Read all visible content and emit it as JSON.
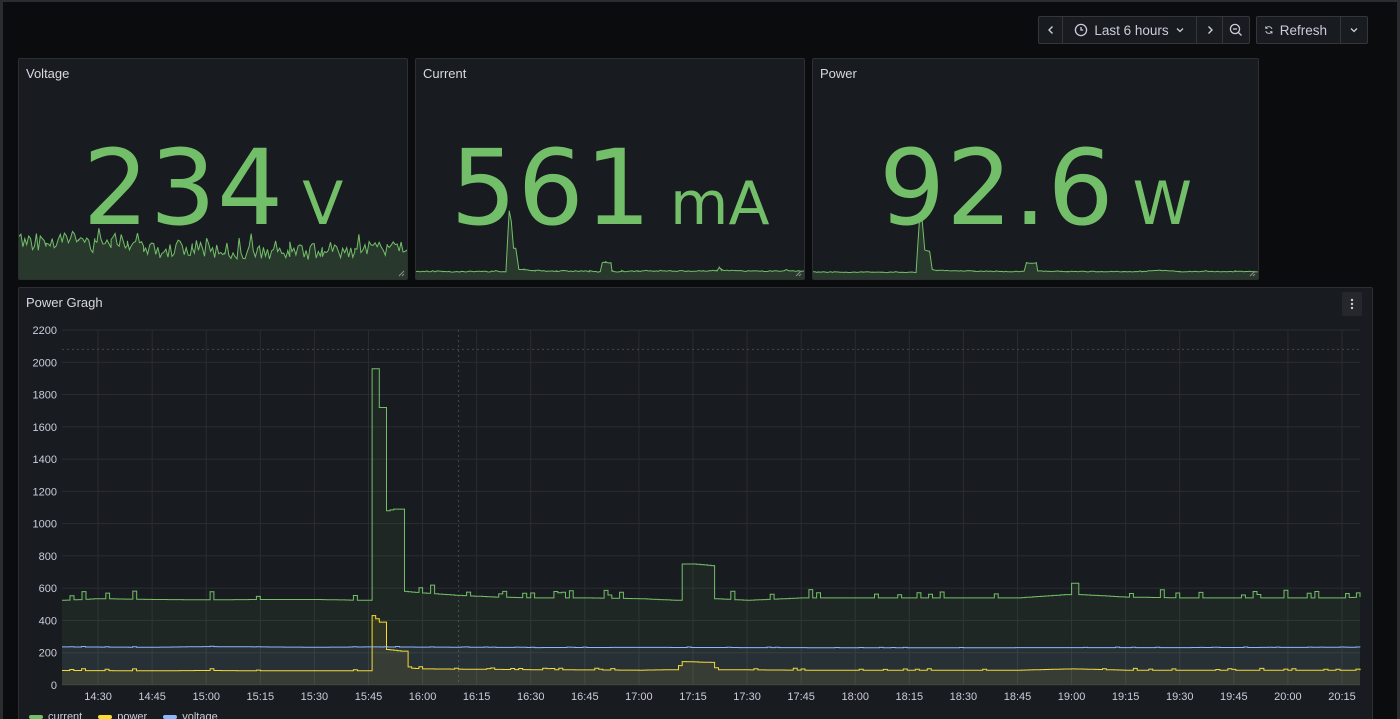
{
  "toolbar": {
    "time_range_label": "Last 6 hours",
    "refresh_label": "Refresh"
  },
  "panels": [
    {
      "title": "Voltage",
      "value": "234",
      "unit": "V"
    },
    {
      "title": "Current",
      "value": "561",
      "unit": "mA"
    },
    {
      "title": "Power",
      "value": "92.6",
      "unit": "W"
    }
  ],
  "graph": {
    "title": "Power Gragh"
  },
  "colors": {
    "accent_green": "#73bf69",
    "yellow": "#fade2a",
    "blue": "#8ab8ff",
    "panel_bg": "#181b1f"
  },
  "chart_data": {
    "type": "line",
    "title": "Power Gragh",
    "x": [
      "14:30",
      "14:45",
      "15:00",
      "15:15",
      "15:30",
      "15:45",
      "16:00",
      "16:15",
      "16:30",
      "16:45",
      "17:00",
      "17:15",
      "17:30",
      "17:45",
      "18:00",
      "18:15",
      "18:30",
      "18:45",
      "19:00",
      "19:15",
      "19:30",
      "19:45",
      "20:00",
      "20:15"
    ],
    "ylim": [
      0,
      2200
    ],
    "yticks": [
      0,
      200,
      400,
      600,
      800,
      1000,
      1200,
      1400,
      1600,
      1800,
      2000,
      2200
    ],
    "grid": true,
    "legend_position": "bottom-left",
    "series": [
      {
        "name": "current",
        "color": "#73bf69",
        "points": [
          [
            "14:20",
            525
          ],
          [
            "14:30",
            535
          ],
          [
            "14:45",
            530
          ],
          [
            "15:00",
            528
          ],
          [
            "15:15",
            530
          ],
          [
            "15:30",
            530
          ],
          [
            "15:43",
            525
          ],
          [
            "15:46",
            1960
          ],
          [
            "15:48",
            1720
          ],
          [
            "15:50",
            1080
          ],
          [
            "15:52",
            1090
          ],
          [
            "15:55",
            580
          ],
          [
            "16:00",
            570
          ],
          [
            "16:10",
            555
          ],
          [
            "16:20",
            545
          ],
          [
            "16:30",
            540
          ],
          [
            "16:45",
            540
          ],
          [
            "17:00",
            535
          ],
          [
            "17:10",
            525
          ],
          [
            "17:12",
            750
          ],
          [
            "17:15",
            750
          ],
          [
            "17:20",
            740
          ],
          [
            "17:21",
            535
          ],
          [
            "17:30",
            525
          ],
          [
            "17:45",
            540
          ],
          [
            "18:00",
            540
          ],
          [
            "18:15",
            540
          ],
          [
            "18:30",
            540
          ],
          [
            "18:45",
            540
          ],
          [
            "18:58",
            560
          ],
          [
            "19:00",
            630
          ],
          [
            "19:02",
            560
          ],
          [
            "19:15",
            545
          ],
          [
            "19:30",
            540
          ],
          [
            "19:45",
            540
          ],
          [
            "20:00",
            540
          ],
          [
            "20:15",
            540
          ],
          [
            "20:20",
            545
          ]
        ]
      },
      {
        "name": "power",
        "color": "#fade2a",
        "points": [
          [
            "14:20",
            90
          ],
          [
            "14:45",
            88
          ],
          [
            "15:00",
            90
          ],
          [
            "15:15",
            88
          ],
          [
            "15:30",
            88
          ],
          [
            "15:43",
            88
          ],
          [
            "15:46",
            430
          ],
          [
            "15:48",
            390
          ],
          [
            "15:50",
            220
          ],
          [
            "15:54",
            210
          ],
          [
            "15:56",
            105
          ],
          [
            "16:00",
            100
          ],
          [
            "16:30",
            95
          ],
          [
            "17:00",
            92
          ],
          [
            "17:10",
            95
          ],
          [
            "17:12",
            145
          ],
          [
            "17:20",
            140
          ],
          [
            "17:21",
            95
          ],
          [
            "17:45",
            92
          ],
          [
            "18:00",
            92
          ],
          [
            "18:30",
            92
          ],
          [
            "18:45",
            92
          ],
          [
            "19:00",
            100
          ],
          [
            "19:15",
            92
          ],
          [
            "19:30",
            92
          ],
          [
            "20:00",
            92
          ],
          [
            "20:20",
            92
          ]
        ]
      },
      {
        "name": "voltage",
        "color": "#8ab8ff",
        "points": [
          [
            "14:20",
            236
          ],
          [
            "14:45",
            234
          ],
          [
            "15:00",
            238
          ],
          [
            "15:15",
            236
          ],
          [
            "15:30",
            234
          ],
          [
            "15:45",
            236
          ],
          [
            "16:00",
            235
          ],
          [
            "16:15",
            234
          ],
          [
            "16:30",
            232
          ],
          [
            "17:00",
            233
          ],
          [
            "17:30",
            232
          ],
          [
            "18:00",
            231
          ],
          [
            "18:30",
            231
          ],
          [
            "19:00",
            232
          ],
          [
            "19:30",
            232
          ],
          [
            "20:00",
            233
          ],
          [
            "20:20",
            234
          ]
        ]
      }
    ]
  }
}
